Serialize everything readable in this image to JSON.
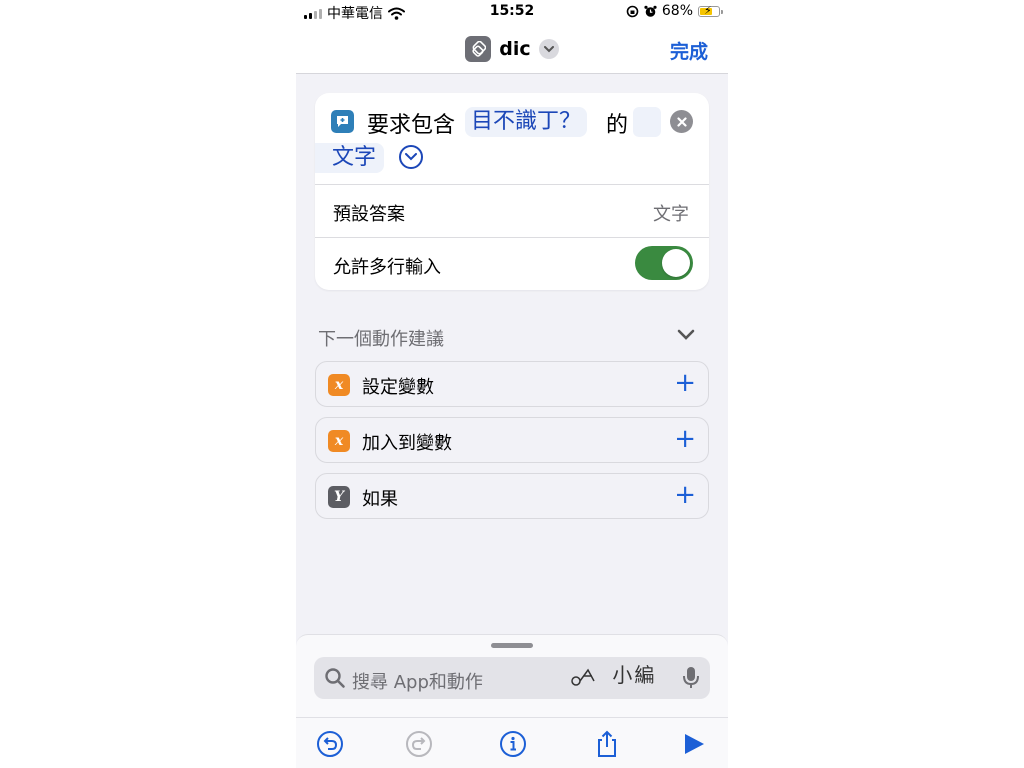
{
  "status": {
    "carrier": "中華電信",
    "time": "15:52",
    "battery": "68%",
    "battery_level": 0.68
  },
  "nav": {
    "title": "dic",
    "done": "完成"
  },
  "action": {
    "prefix": "要求包含",
    "prompt": "目不識丁？",
    "particle": "的",
    "type": "文字",
    "rows": [
      {
        "label": "預設答案",
        "value": "文字"
      },
      {
        "label": "允許多行輸入"
      }
    ],
    "multiline_enabled": true
  },
  "suggestions": {
    "title": "下一個動作建議",
    "items": [
      {
        "label": "設定變數",
        "icon": "variable-icon",
        "color": "#f08a24",
        "glyph": "x"
      },
      {
        "label": "加入到變數",
        "icon": "variable-icon",
        "color": "#f08a24",
        "glyph": "x"
      },
      {
        "label": "如果",
        "icon": "branch-icon",
        "color": "#5c5d63",
        "glyph": "Y"
      }
    ]
  },
  "search": {
    "placeholder": "搜尋 App和動作",
    "watermark": "小編"
  },
  "colors": {
    "accent": "#1c5fd6",
    "token_text": "#1c47b8",
    "toggle_on": "#3a8a40"
  }
}
